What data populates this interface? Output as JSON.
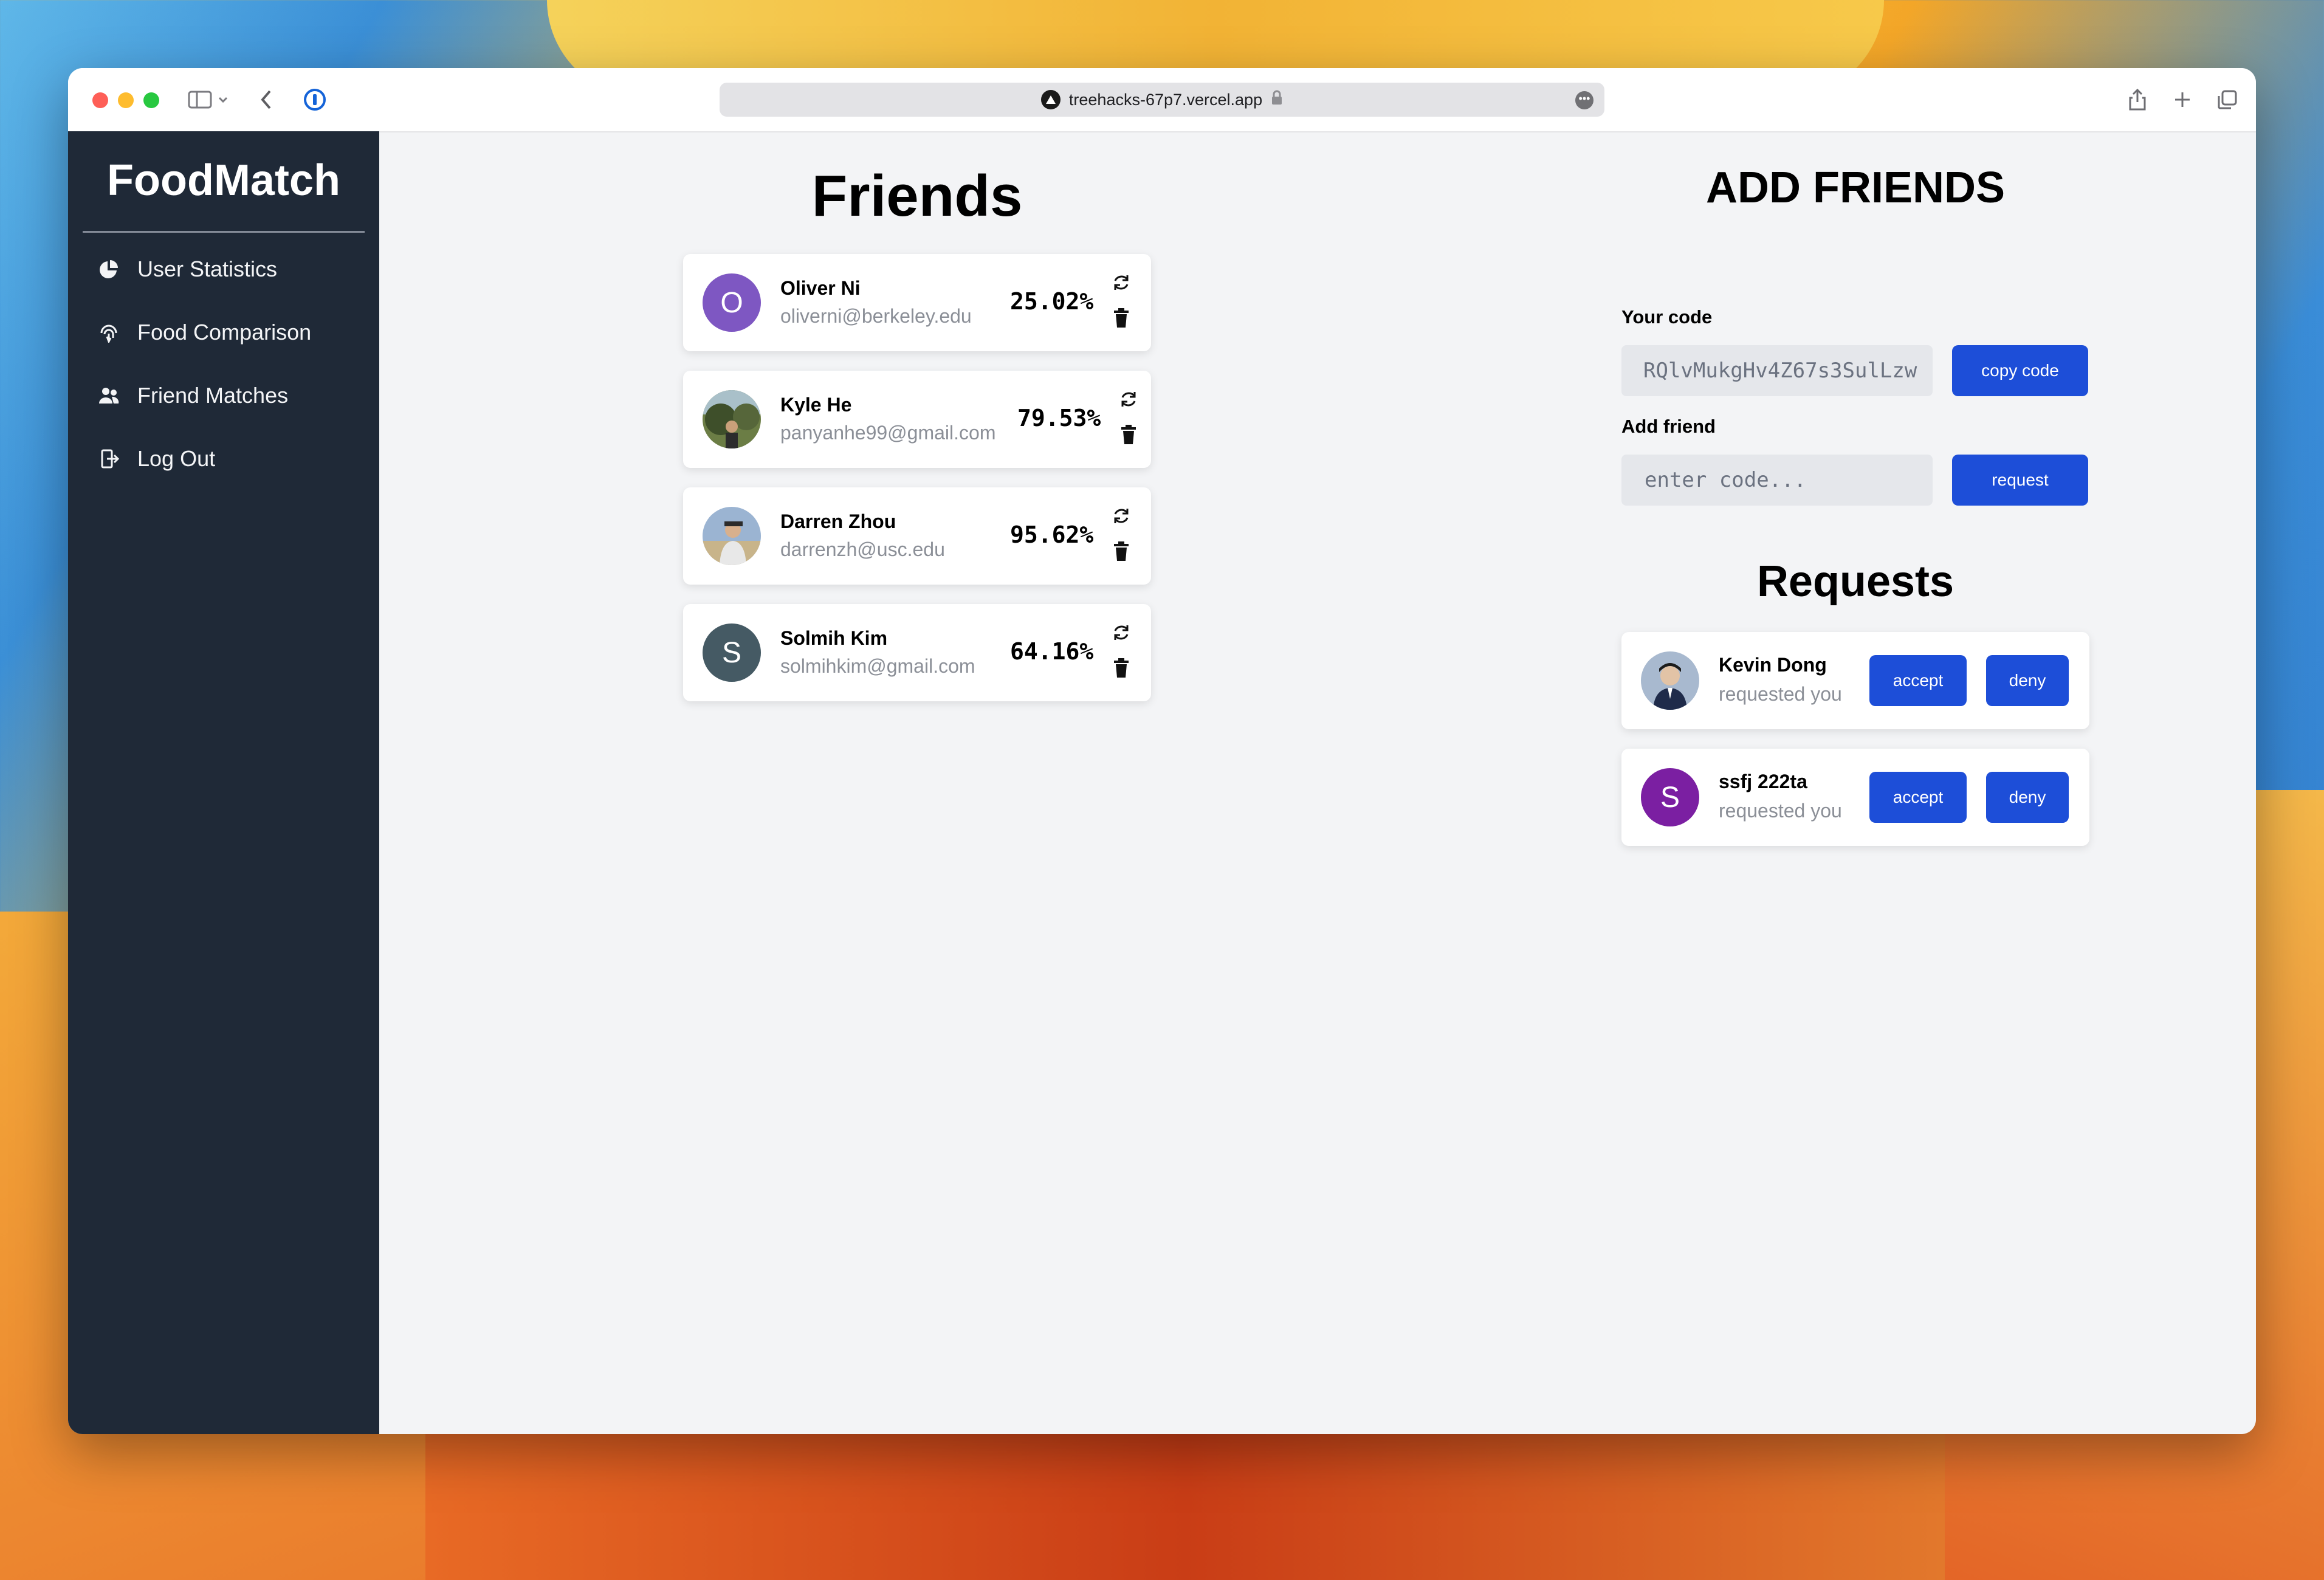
{
  "browser": {
    "url": "treehacks-67p7.vercel.app"
  },
  "sidebar": {
    "brand": "FoodMatch",
    "items": [
      {
        "label": "User Statistics",
        "icon": "pie-chart-icon"
      },
      {
        "label": "Food Comparison",
        "icon": "fingerprint-icon"
      },
      {
        "label": "Friend Matches",
        "icon": "users-icon"
      },
      {
        "label": "Log Out",
        "icon": "logout-icon"
      }
    ]
  },
  "friends": {
    "title": "Friends",
    "list": [
      {
        "name": "Oliver Ni",
        "email": "oliverni@berkeley.edu",
        "match": "25.02%",
        "initial": "O",
        "avatar_color": "#7e57c2"
      },
      {
        "name": "Kyle He",
        "email": "panyanhe99@gmail.com",
        "match": "79.53%",
        "initial": "",
        "avatar_color": "#5a6b3a"
      },
      {
        "name": "Darren Zhou",
        "email": "darrenzh@usc.edu",
        "match": "95.62%",
        "initial": "",
        "avatar_color": "#8fa4bd"
      },
      {
        "name": "Solmih Kim",
        "email": "solmihkim@gmail.com",
        "match": "64.16%",
        "initial": "S",
        "avatar_color": "#455a64"
      }
    ]
  },
  "add_friends": {
    "title": "ADD FRIENDS",
    "your_code_label": "Your code",
    "your_code": "RQlvMukgHv4Z67s3SulLzw",
    "copy_button": "copy code",
    "add_friend_label": "Add friend",
    "add_placeholder": "enter code...",
    "request_button": "request"
  },
  "requests": {
    "title": "Requests",
    "list": [
      {
        "name": "Kevin Dong",
        "sub": "requested you",
        "initial": "",
        "avatar_color": "#3c4a5e",
        "accept": "accept",
        "deny": "deny"
      },
      {
        "name": "ssfj 222ta",
        "sub": "requested you",
        "initial": "S",
        "avatar_color": "#7b1fa2",
        "accept": "accept",
        "deny": "deny"
      }
    ]
  }
}
